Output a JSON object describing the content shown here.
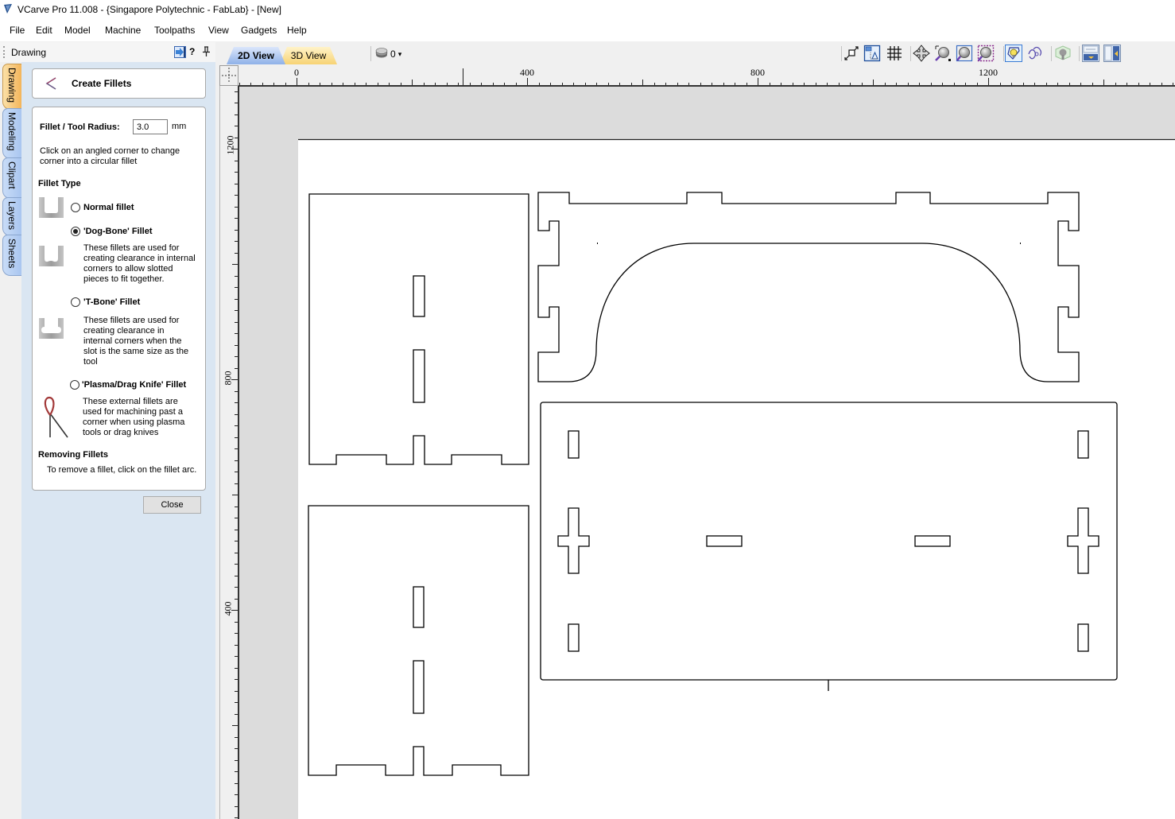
{
  "window": {
    "title": "VCarve Pro 11.008 - {Singapore Polytechnic - FabLab} - [New]",
    "app_icon": "vcarve-logo-icon"
  },
  "menu": [
    "File",
    "Edit",
    "Model",
    "Machine",
    "Toolpaths",
    "View",
    "Gadgets",
    "Help"
  ],
  "panel": {
    "title": "Drawing",
    "header_icons": [
      "auto-hide-arrow-icon",
      "help-icon",
      "pin-icon"
    ],
    "help_glyph": "?",
    "side_tabs": [
      "Drawing",
      "Modeling",
      "Clipart",
      "Layers",
      "Sheets"
    ],
    "active_side_tab": "Drawing",
    "tool_title": "Create Fillets",
    "radius_label": "Fillet / Tool Radius:",
    "radius_value": "3.0",
    "radius_unit": "mm",
    "instructions_lines": [
      "Click on an angled corner to change",
      "corner into a circular fillet"
    ],
    "fillet_type_heading": "Fillet Type",
    "fillet_types": [
      {
        "label": "Normal fillet",
        "checked": false,
        "description_lines": []
      },
      {
        "label": "'Dog-Bone' Fillet",
        "checked": true,
        "description_lines": [
          "These fillets are used for",
          "creating clearance in internal",
          "corners to allow slotted",
          "pieces to fit together."
        ]
      },
      {
        "label": "'T-Bone' Fillet",
        "checked": false,
        "description_lines": [
          "These fillets are used for",
          "creating clearance in",
          "internal corners when the",
          "slot is the same size as the",
          "tool"
        ]
      },
      {
        "label": "'Plasma/Drag Knife' Fillet",
        "checked": false,
        "description_lines": [
          "These external fillets are",
          "used for machining past a",
          "corner when using plasma",
          "tools or drag knives"
        ]
      }
    ],
    "removing_heading": "Removing Fillets",
    "removing_text": "To remove a fillet, click on the fillet arc.",
    "close_label": "Close"
  },
  "view_tabs": [
    {
      "label": "2D View",
      "active": true
    },
    {
      "label": "3D View",
      "active": false
    }
  ],
  "layer_selector": {
    "value": "0",
    "arrow": "▾"
  },
  "toolbar": {
    "icons": [
      "job-size-icon",
      "material-setup-icon",
      "snap-grid-icon",
      "pan-icon",
      "zoom-box-icon",
      "zoom-extents-icon",
      "zoom-selection-icon",
      "node-edit-icon",
      "transform-icon",
      "toolpath-preview-icon",
      "layout-horizontal-icon",
      "layout-vertical-icon"
    ]
  },
  "rulers": {
    "horizontal_labels": [
      "0",
      "400",
      "800",
      "1200"
    ],
    "vertical_labels": [
      "1200",
      "800",
      "400"
    ]
  }
}
